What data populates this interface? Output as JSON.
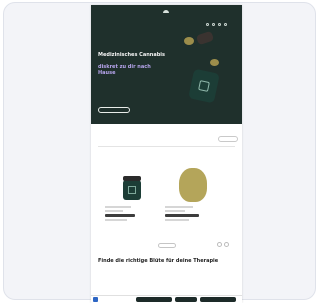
{
  "header": {
    "logo_text": ""
  },
  "hero": {
    "title": "Medizinisches Cannabis",
    "subtitle": "diskret zu dir nach Hause",
    "text": "",
    "cta_label": ""
  },
  "section": {
    "title": "",
    "button_label": "",
    "text": ""
  },
  "more_button_label": "",
  "section2": {
    "title": "Finde die richtige Blüte für deine Therapie",
    "text": ""
  },
  "cookie": {
    "text": "",
    "buttons": [
      "",
      "",
      ""
    ]
  },
  "colors": {
    "hero_bg": "#1f302c",
    "accent_purple": "#b6a4ec",
    "accent_orange": "#e3813a",
    "cookie_badge": "#2d66c4"
  }
}
